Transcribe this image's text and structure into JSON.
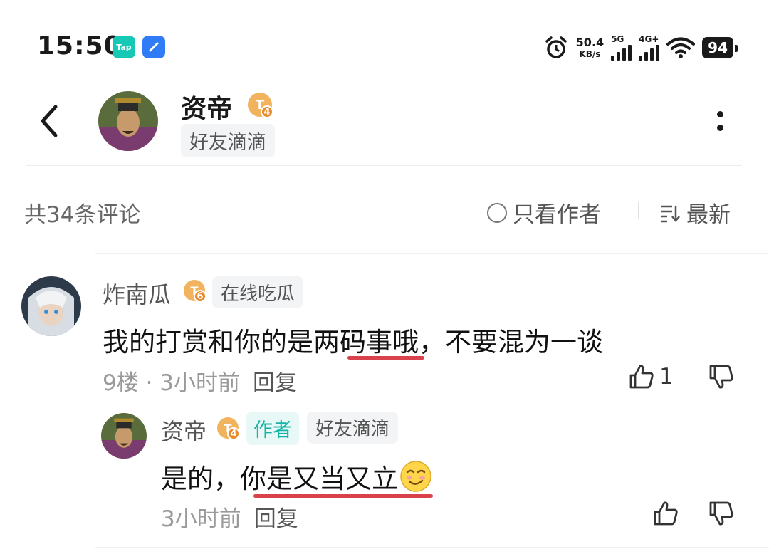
{
  "status_bar": {
    "time": "15:50",
    "app_icon_1": "Tap",
    "net_speed_value": "50.4",
    "net_speed_unit": "KB/s",
    "signal_1_label": "5G",
    "signal_2_label": "4G+",
    "battery": "94"
  },
  "header": {
    "name": "资帝",
    "level": "T",
    "level_num": "4",
    "tag": "好友滴滴"
  },
  "filter": {
    "count_label": "共34条评论",
    "only_author_label": "只看作者",
    "sort_label": "最新"
  },
  "comment": {
    "author": "炸南瓜",
    "level": "T",
    "level_num": "6",
    "tag": "在线吃瓜",
    "text": "我的打赏和你的是两码事哦，不要混为一谈",
    "floor": "9楼 · 3小时前",
    "reply_label": "回复",
    "like_count": "1"
  },
  "reply": {
    "author": "资帝",
    "level": "T",
    "level_num": "4",
    "author_badge": "作者",
    "tag": "好友滴滴",
    "text": "是的，你是又当又立",
    "time": "3小时前",
    "reply_label": "回复"
  },
  "colors": {
    "accent_teal": "#16b3a6",
    "underline_red": "#d9424a",
    "level_badge": "#f2b35e"
  }
}
